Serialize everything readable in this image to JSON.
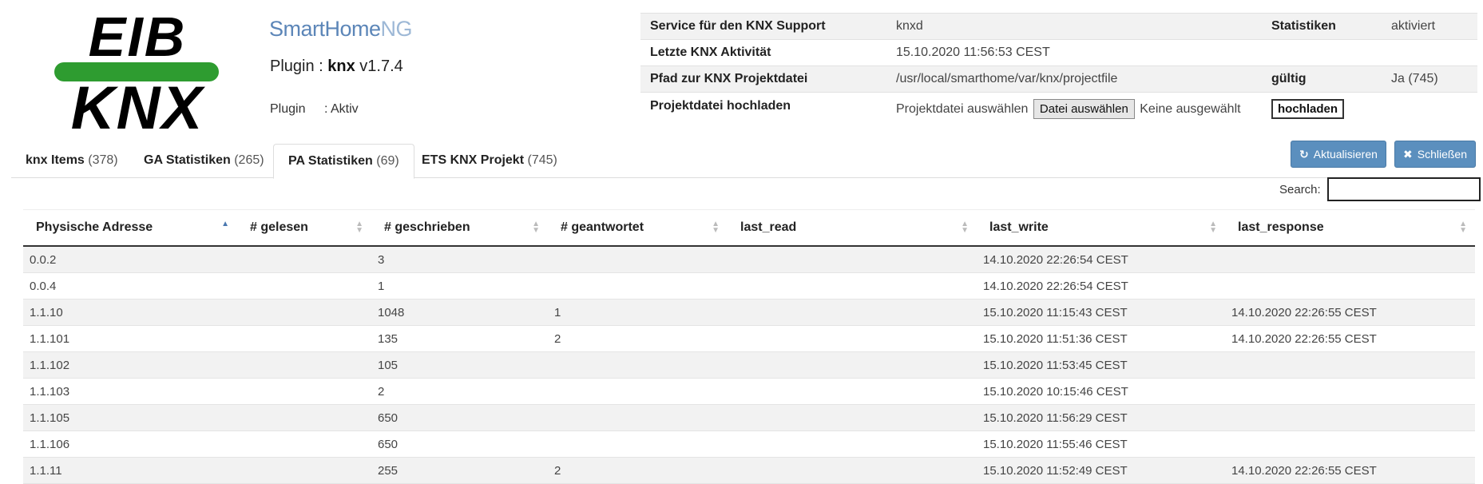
{
  "logo": {
    "top": "EIB",
    "bottom": "KNX"
  },
  "shng_logo": {
    "prefix": "SmartHome",
    "suffix": "NG"
  },
  "plugin": {
    "label": "Plugin : ",
    "name": "knx",
    "version": "v1.7.4",
    "status_label": "Plugin",
    "status_value": ": Aktiv"
  },
  "info": {
    "service_key": "Service für den KNX Support",
    "service_val": "knxd",
    "stats_key": "Statistiken",
    "stats_val": "aktiviert",
    "activity_key": "Letzte KNX Aktivität",
    "activity_val": "15.10.2020 11:56:53 CEST",
    "path_key": "Pfad zur KNX Projektdatei",
    "path_val": "/usr/local/smarthome/var/knx/projectfile",
    "valid_key": "gültig",
    "valid_val": "Ja (745)",
    "upload_key": "Projektdatei hochladen",
    "upload_label": "Projektdatei auswählen",
    "file_button": "Datei auswählen",
    "file_none": "Keine ausgewählt",
    "upload_button": "hochladen"
  },
  "tabs": [
    {
      "label": "knx Items",
      "count": "(378)"
    },
    {
      "label": "GA Statistiken",
      "count": "(265)"
    },
    {
      "label": "PA Statistiken",
      "count": "(69)"
    },
    {
      "label": "ETS KNX Projekt",
      "count": "(745)"
    }
  ],
  "buttons": {
    "refresh": "Aktualisieren",
    "close": "Schließen"
  },
  "search": {
    "label": "Search:",
    "value": ""
  },
  "table": {
    "headers": [
      "Physische Adresse",
      "# gelesen",
      "# geschrieben",
      "# geantwortet",
      "last_read",
      "last_write",
      "last_response"
    ],
    "rows": [
      [
        "0.0.2",
        "",
        "3",
        "",
        "",
        "14.10.2020 22:26:54 CEST",
        ""
      ],
      [
        "0.0.4",
        "",
        "1",
        "",
        "",
        "14.10.2020 22:26:54 CEST",
        ""
      ],
      [
        "1.1.10",
        "",
        "1048",
        "1",
        "",
        "15.10.2020 11:15:43 CEST",
        "14.10.2020 22:26:55 CEST"
      ],
      [
        "1.1.101",
        "",
        "135",
        "2",
        "",
        "15.10.2020 11:51:36 CEST",
        "14.10.2020 22:26:55 CEST"
      ],
      [
        "1.1.102",
        "",
        "105",
        "",
        "",
        "15.10.2020 11:53:45 CEST",
        ""
      ],
      [
        "1.1.103",
        "",
        "2",
        "",
        "",
        "15.10.2020 10:15:46 CEST",
        ""
      ],
      [
        "1.1.105",
        "",
        "650",
        "",
        "",
        "15.10.2020 11:56:29 CEST",
        ""
      ],
      [
        "1.1.106",
        "",
        "650",
        "",
        "",
        "15.10.2020 11:55:46 CEST",
        ""
      ],
      [
        "1.1.11",
        "",
        "255",
        "2",
        "",
        "15.10.2020 11:52:49 CEST",
        "14.10.2020 22:26:55 CEST"
      ]
    ]
  },
  "colors": {
    "accent": "#5b8fbe",
    "logo_green": "#2e9c30",
    "shng_blue": "#5c86b8"
  }
}
